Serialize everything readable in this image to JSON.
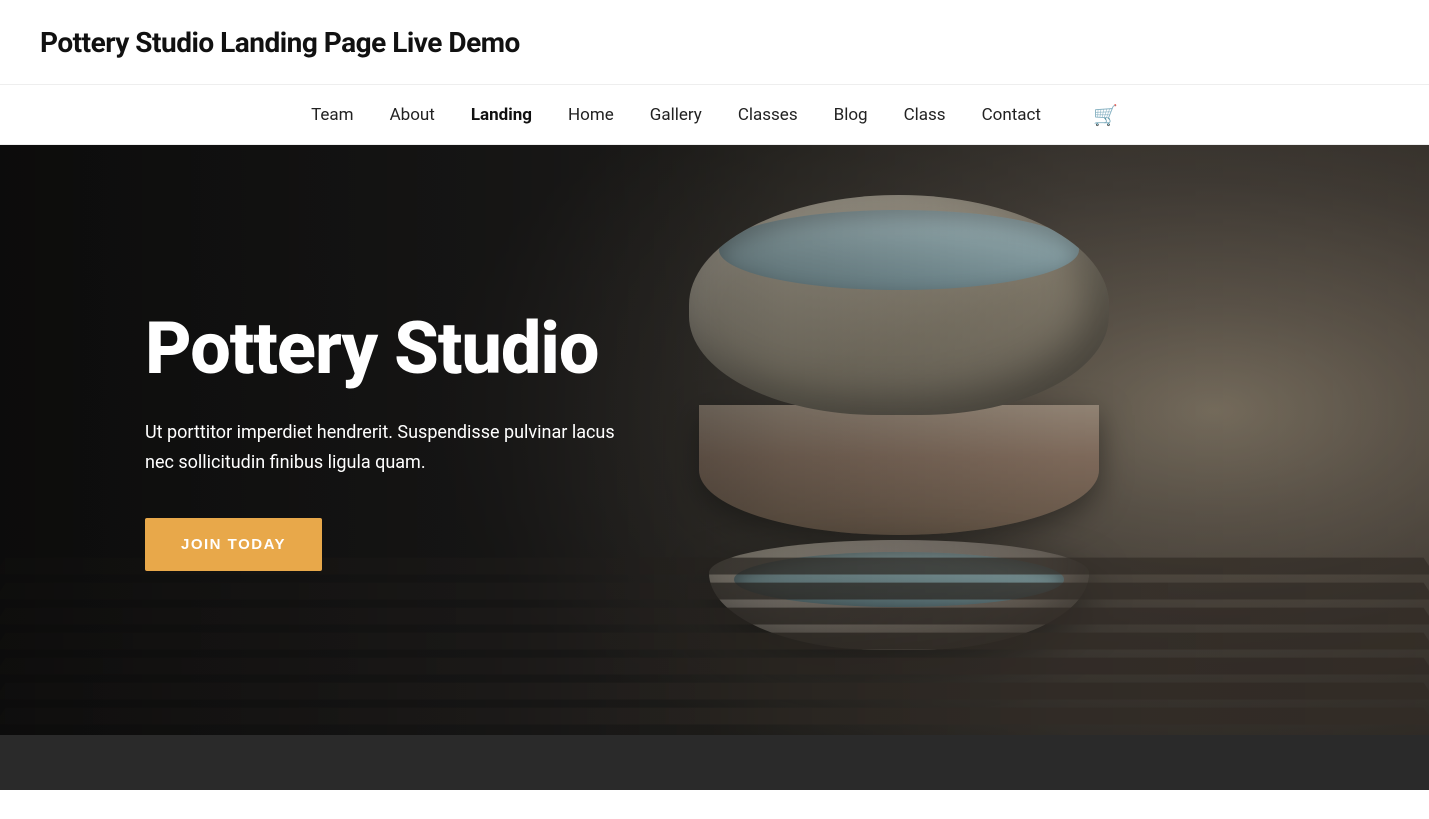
{
  "top_bar": {
    "site_title": "Pottery Studio Landing Page Live Demo"
  },
  "nav": {
    "items": [
      {
        "label": "Team",
        "active": false
      },
      {
        "label": "About",
        "active": false
      },
      {
        "label": "Landing",
        "active": true
      },
      {
        "label": "Home",
        "active": false
      },
      {
        "label": "Gallery",
        "active": false
      },
      {
        "label": "Classes",
        "active": false
      },
      {
        "label": "Blog",
        "active": false
      },
      {
        "label": "Class",
        "active": false
      },
      {
        "label": "Contact",
        "active": false
      }
    ],
    "cart_icon": "🛒"
  },
  "hero": {
    "title": "Pottery Studio",
    "description": "Ut porttitor imperdiet hendrerit. Suspendisse pulvinar lacus nec sollicitudin finibus ligula quam.",
    "cta_label": "JOIN TODAY"
  }
}
